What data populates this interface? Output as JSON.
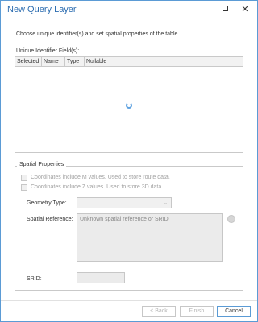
{
  "window": {
    "title": "New Query Layer",
    "maximize_icon": "maximize-icon",
    "close_icon": "close-icon",
    "close_glyph": "✕"
  },
  "main": {
    "instruction": "Choose unique identifier(s) and set spatial properties of the table.",
    "unique_identifier_label": "Unique Identifier Field(s):",
    "table": {
      "columns": [
        "Selected",
        "Name",
        "Type",
        "Nullable"
      ],
      "rows": [],
      "loading": true
    }
  },
  "spatial": {
    "group_label": "Spatial Properties",
    "m_values_label": "Coordinates include M values. Used to store route data.",
    "z_values_label": "Coordinates include Z values. Used to store 3D data.",
    "geometry_type_label": "Geometry Type:",
    "geometry_type_value": "",
    "spatial_reference_label": "Spatial Reference:",
    "spatial_reference_value": "Unknown spatial reference or SRID",
    "srid_label": "SRID:",
    "srid_value": ""
  },
  "footer": {
    "back_label": "< Back",
    "finish_label": "Finish",
    "cancel_label": "Cancel"
  },
  "colors": {
    "title": "#2b6cb0",
    "accent": "#5b9bd5",
    "disabled_text": "#a0a0a0"
  }
}
